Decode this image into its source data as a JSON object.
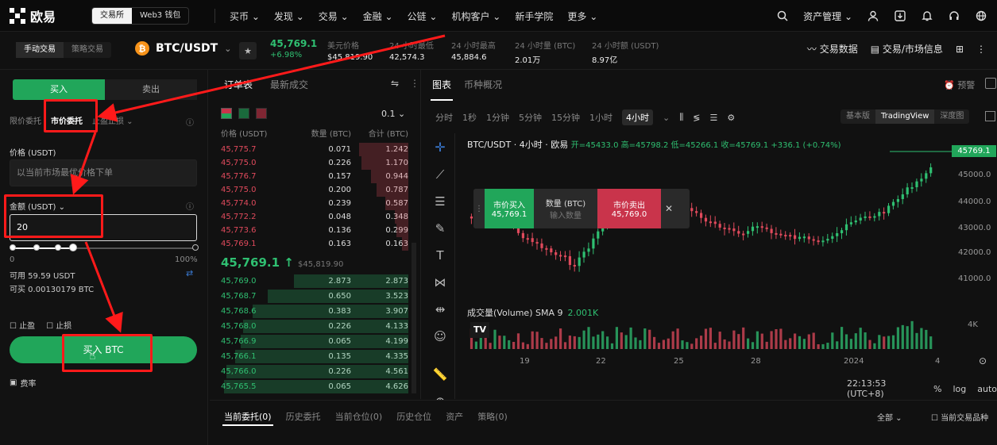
{
  "nav": {
    "seg": [
      "交易所",
      "Web3 钱包"
    ],
    "menu": [
      "买币",
      "发现",
      "交易",
      "金融",
      "公链",
      "机构客户",
      "新手学院",
      "更多"
    ],
    "right_label": "资产管理",
    "logo_text": "欧易"
  },
  "ticker": {
    "modes": [
      "手动交易",
      "策略交易"
    ],
    "pair": "BTC/USDT",
    "last": "45,769.1",
    "change": "+6.98%",
    "stats": [
      {
        "label": "美元价格",
        "value": "$45,819.90"
      },
      {
        "label": "24 小时最低",
        "value": "42,574.3"
      },
      {
        "label": "24 小时最高",
        "value": "45,884.6"
      },
      {
        "label": "24 小时量 (BTC)",
        "value": "2.01万"
      },
      {
        "label": "24 小时额 (USDT)",
        "value": "8.97亿"
      }
    ],
    "right": [
      "交易数据",
      "交易/市场信息"
    ]
  },
  "order": {
    "buy": "买入",
    "sell": "卖出",
    "types": [
      "限价委托",
      "市价委托",
      "止盈止损"
    ],
    "price_label": "价格 (USDT)",
    "price_placeholder": "以当前市场最优价格下单",
    "amount_label": "金额 (USDT)",
    "amount_value": "20",
    "slider_min": "0",
    "slider_max": "100%",
    "slider_level": 0.33,
    "available": "可用 59.59 USDT",
    "can_buy": "可买 0.00130179 BTC",
    "tp": "止盈",
    "sl": "止损",
    "buy_button": "买入 BTC",
    "fee": "费率"
  },
  "book": {
    "tabs": [
      "订单表",
      "最新成交"
    ],
    "precision": "0.1",
    "headers": [
      "价格 (USDT)",
      "数量 (BTC)",
      "合计 (BTC)"
    ],
    "asks": [
      [
        "45,775.7",
        "0.071",
        "1.242"
      ],
      [
        "45,775.0",
        "0.226",
        "1.170"
      ],
      [
        "45,776.7",
        "0.157",
        "0.944"
      ],
      [
        "45,775.0",
        "0.200",
        "0.787"
      ],
      [
        "45,774.0",
        "0.239",
        "0.587"
      ],
      [
        "45,772.2",
        "0.048",
        "0.348"
      ],
      [
        "45,773.6",
        "0.136",
        "0.299"
      ],
      [
        "45,769.1",
        "0.163",
        "0.163"
      ]
    ],
    "mid_price": "45,769.1 ↑",
    "mid_usd": "$45,819.90",
    "bids": [
      [
        "45,769.0",
        "2.873",
        "2.873"
      ],
      [
        "45,768.7",
        "0.650",
        "3.523"
      ],
      [
        "45,768.6",
        "0.383",
        "3.907"
      ],
      [
        "45,768.0",
        "0.226",
        "4.133"
      ],
      [
        "45,766.9",
        "0.065",
        "4.199"
      ],
      [
        "45,766.1",
        "0.135",
        "4.335"
      ],
      [
        "45,766.0",
        "0.226",
        "4.561"
      ],
      [
        "45,765.5",
        "0.065",
        "4.626"
      ]
    ]
  },
  "chart": {
    "tabs": [
      "图表",
      "币种概况"
    ],
    "alert": "预警",
    "intervals": [
      "分时",
      "1秒",
      "1分钟",
      "5分钟",
      "15分钟",
      "1小时",
      "4小时"
    ],
    "views": [
      "基本版",
      "TradingView",
      "深度图"
    ],
    "legend": "BTC/USDT · 4小时 · 欧易",
    "ohlc": "开=45433.0 高=45798.2 低=45266.1 收=45769.1 +336.1 (+0.74%)",
    "last_tag": "45769.1",
    "yticks": [
      "45000.0",
      "44000.0",
      "43000.0",
      "42000.0",
      "41000.0"
    ],
    "vol_label": "成交量(Volume) SMA 9",
    "vol_value": "2.001K",
    "vol_tick": "4K",
    "xticks": [
      "19",
      "22",
      "25",
      "28",
      "2024",
      "4"
    ],
    "time": "22:13:53 (UTC+8)",
    "scale": [
      "%",
      "log",
      "auto"
    ],
    "quick": {
      "buy": "市价买入",
      "buy_price": "45,769.1",
      "qty": "数量 (BTC)",
      "qty_ph": "输入数量",
      "sell": "市价卖出",
      "sell_price": "45,769.0"
    }
  },
  "bottom": {
    "tabs": [
      "当前委托(0)",
      "历史委托",
      "当前仓位(0)",
      "历史仓位",
      "资产",
      "策略(0)"
    ],
    "filter": "全部",
    "checkbox": "当前交易品种"
  },
  "colors": {
    "up": "#2fbf71",
    "down": "#e04a5c",
    "buy": "#21a65a",
    "sell": "#c9344b",
    "annotation": "#ff1a1a"
  }
}
